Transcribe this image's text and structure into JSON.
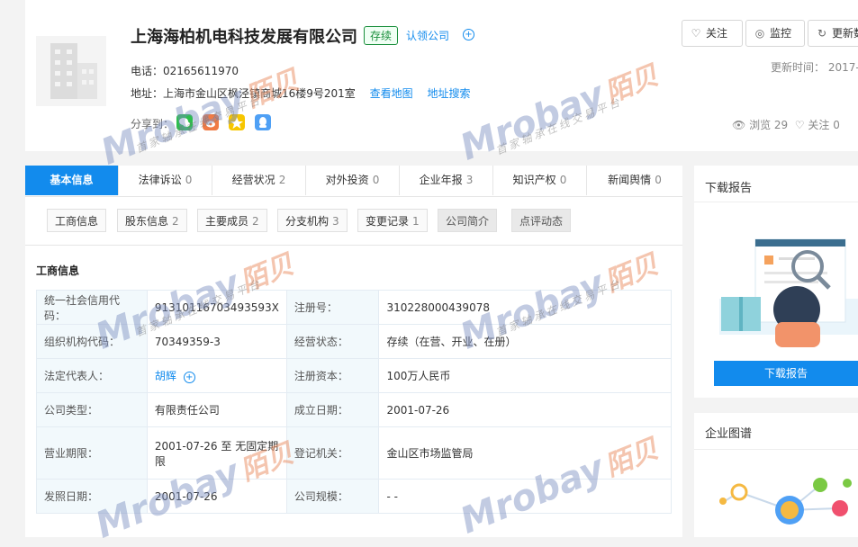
{
  "header": {
    "company_name": "上海海柏机电科技发展有限公司",
    "status_badge": "存续",
    "claim_link": "认领公司",
    "phone": "电话：02165611970",
    "address": "地址：上海市金山区枫泾镇商城16楼9号201室",
    "view_map": "查看地图",
    "address_search": "地址搜索",
    "share_label": "分享到：",
    "share_icons": [
      "wechat-icon",
      "weibo-icon",
      "qzone-icon",
      "qq-icon"
    ],
    "buttons": {
      "follow": "关注",
      "monitor": "监控",
      "update": "更新数"
    },
    "update_time": "更新时间： 2017-",
    "stats": {
      "views": "浏览 29",
      "follows": "关注 0"
    }
  },
  "tabs": [
    {
      "label": "基本信息",
      "count": ""
    },
    {
      "label": "法律诉讼",
      "count": "0"
    },
    {
      "label": "经营状况",
      "count": "2"
    },
    {
      "label": "对外投资",
      "count": "0"
    },
    {
      "label": "企业年报",
      "count": "3"
    },
    {
      "label": "知识产权",
      "count": "0"
    },
    {
      "label": "新闻舆情",
      "count": "0"
    }
  ],
  "subtabs": [
    {
      "label": "工商信息",
      "count": ""
    },
    {
      "label": "股东信息",
      "count": "2"
    },
    {
      "label": "主要成员",
      "count": "2"
    },
    {
      "label": "分支机构",
      "count": "3"
    },
    {
      "label": "变更记录",
      "count": "1"
    },
    {
      "label": "公司简介",
      "count": ""
    },
    {
      "label": "点评动态",
      "count": ""
    }
  ],
  "section_title": "工商信息",
  "info_rows": [
    {
      "l1": "统一社会信用代码：",
      "v1": "91310116703493593X",
      "l2": "注册号：",
      "v2": "310228000439078"
    },
    {
      "l1": "组织机构代码：",
      "v1": "70349359-3",
      "l2": "经营状态：",
      "v2": "存续（在营、开业、在册）"
    },
    {
      "l1": "法定代表人：",
      "v1": "胡辉",
      "l2": "注册资本：",
      "v2": "100万人民币"
    },
    {
      "l1": "公司类型：",
      "v1": "有限责任公司",
      "l2": "成立日期：",
      "v2": "2001-07-26"
    },
    {
      "l1": "营业期限：",
      "v1": "2001-07-26 至 无固定期限",
      "l2": "登记机关：",
      "v2": "金山区市场监管局"
    },
    {
      "l1": "发照日期：",
      "v1": "2001-07-26",
      "l2": "公司规模：",
      "v2": "- -"
    }
  ],
  "right": {
    "report_title": "下载报告",
    "report_button": "下载报告",
    "graph_title": "企业图谱"
  },
  "watermark": {
    "brand": "Mrobay",
    "brand_cn": "陌贝",
    "slogan": "首家轴承在线交易平台"
  }
}
